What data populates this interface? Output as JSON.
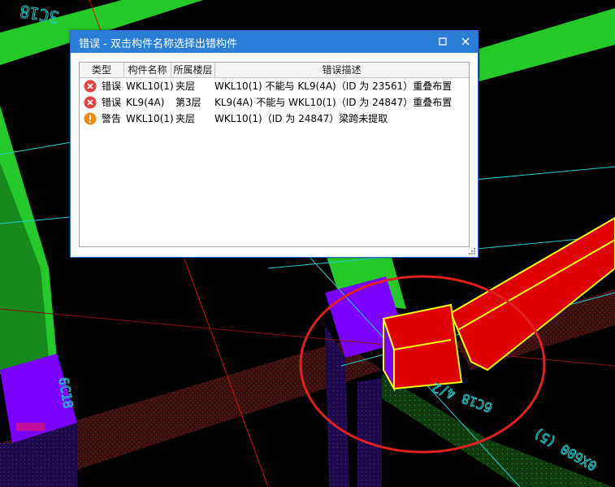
{
  "dialog": {
    "title": "错误 - 双击构件名称选择出错构件",
    "columns": [
      "类型",
      "构件名称",
      "所属楼层",
      "错误描述"
    ],
    "rows": [
      {
        "icon": "error-icon",
        "type": "错误",
        "name": "WKL10(1)",
        "floor": "夹层",
        "desc": "WKL10(1) 不能与 KL9(4A)（ID 为 23561）重叠布置"
      },
      {
        "icon": "error-icon",
        "type": "错误",
        "name": "KL9(4A)",
        "floor": "第3层",
        "desc": "KL9(4A) 不能与 WKL10(1)（ID 为 24847）重叠布置"
      },
      {
        "icon": "warning-icon",
        "type": "警告",
        "name": "WKL10(1)",
        "floor": "夹层",
        "desc": "WKL10(1)（ID 为 24847）梁跨未提取"
      }
    ]
  },
  "cad_labels": {
    "top_left": "3C18",
    "mid_left": "6C18",
    "mid_right": "6C18 4/2",
    "bottom_right": "0X600 (5)"
  },
  "colors": {
    "titlebar": "#2d7ed8",
    "beam_green": "#25c92a",
    "column_purple": "#7a00ff",
    "highlight_red": "#e00000",
    "selection_yellow": "#ffff00",
    "circle_red": "#e02020",
    "cad_cyan": "#22cccc"
  }
}
